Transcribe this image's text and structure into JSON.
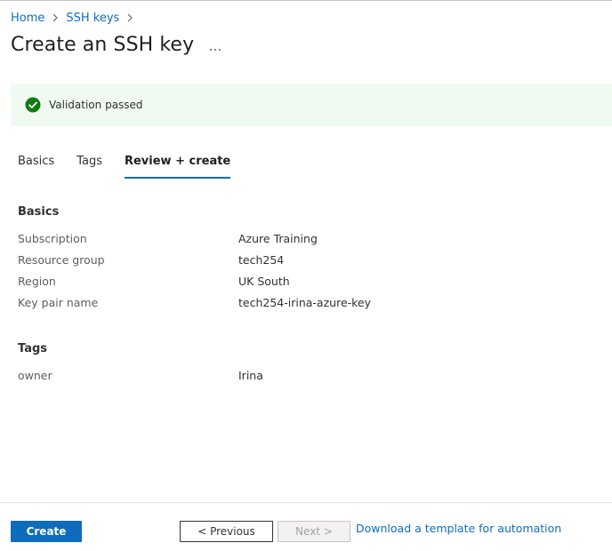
{
  "breadcrumb": {
    "home": "Home",
    "ssh_keys": "SSH keys"
  },
  "page": {
    "title": "Create an SSH key",
    "more_icon": "ellipsis-icon"
  },
  "validation": {
    "message": "Validation passed",
    "status_color": "#107c10",
    "background": "#f1faf1"
  },
  "tabs": [
    {
      "label": "Basics",
      "active": false
    },
    {
      "label": "Tags",
      "active": false
    },
    {
      "label": "Review + create",
      "active": true
    }
  ],
  "basics": {
    "title": "Basics",
    "rows": [
      {
        "label": "Subscription",
        "value": "Azure Training"
      },
      {
        "label": "Resource group",
        "value": "tech254"
      },
      {
        "label": "Region",
        "value": "UK South"
      },
      {
        "label": "Key pair name",
        "value": "tech254-irina-azure-key"
      }
    ]
  },
  "tags": {
    "title": "Tags",
    "rows": [
      {
        "label": "owner",
        "value": "Irina"
      }
    ]
  },
  "footer": {
    "create_label": "Create",
    "previous_label": "< Previous",
    "next_label": "Next >",
    "download_label": "Download a template for automation"
  },
  "colors": {
    "accent": "#0f6cbd",
    "text": "#323130",
    "muted": "#605e5c"
  }
}
